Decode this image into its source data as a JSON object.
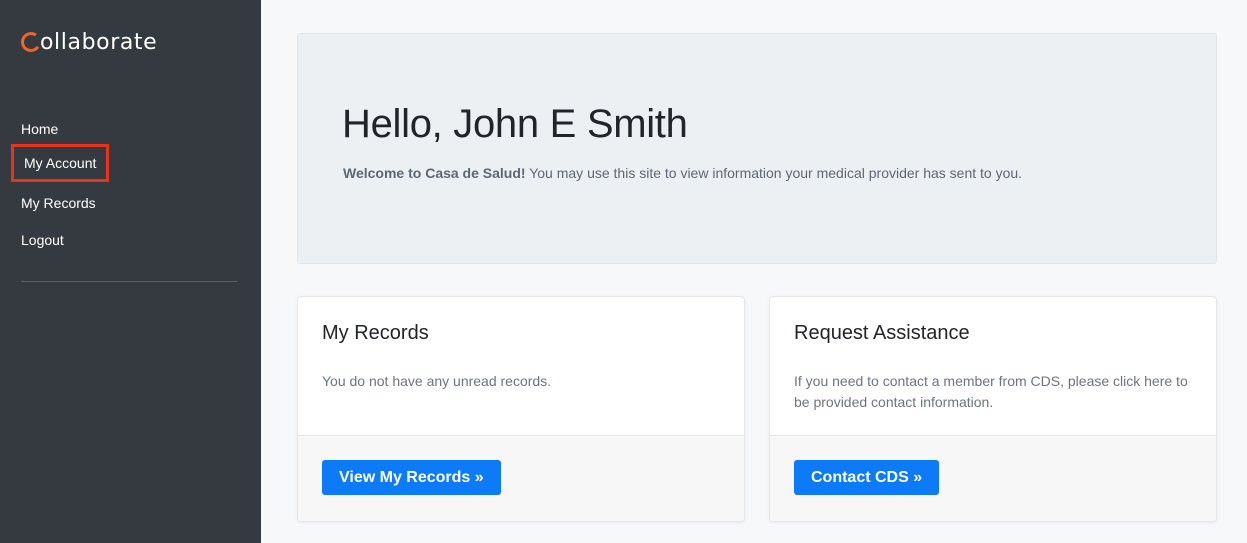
{
  "brand": {
    "logo_text": "ollaborate",
    "logo_full": "collaborate",
    "accent": "#f26522"
  },
  "sidebar": {
    "items": [
      {
        "label": "Home"
      },
      {
        "label": "My Account",
        "highlighted": true
      },
      {
        "label": "My Records"
      },
      {
        "label": "Logout"
      }
    ]
  },
  "hero": {
    "title": "Hello, John E Smith",
    "lead_bold": "Welcome to Casa de Salud!",
    "lead_text": " You may use this site to view information your medical provider has sent to you."
  },
  "cards": {
    "records": {
      "title": "My Records",
      "text": "You do not have any unread records.",
      "button": "View My Records »"
    },
    "assistance": {
      "title": "Request Assistance",
      "text": "If you need to contact a member from CDS, please click here to be provided contact information.",
      "button": "Contact CDS »"
    }
  },
  "colors": {
    "sidebar_bg": "#343a40",
    "primary": "#0d7bf7",
    "highlight_border": "#e8321c"
  }
}
